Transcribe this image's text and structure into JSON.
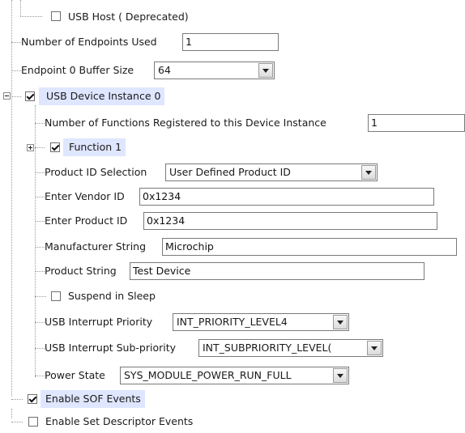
{
  "tree": {
    "usb_host": {
      "label": "USB Host ( Deprecated)",
      "checked": false
    },
    "num_endpoints": {
      "label": "Number of Endpoints Used",
      "value": "1"
    },
    "ep0_buffer": {
      "label": "Endpoint 0 Buffer Size",
      "value": "64"
    },
    "device_instance": {
      "label": "USB Device Instance 0",
      "checked": true
    },
    "num_functions": {
      "label": "Number of Functions Registered to this Device Instance",
      "value": "1"
    },
    "function1": {
      "label": "Function 1",
      "checked": true
    },
    "product_id_selection": {
      "label": "Product ID Selection",
      "value": "User Defined Product ID"
    },
    "vendor_id": {
      "label": "Enter Vendor ID",
      "value": "0x1234"
    },
    "product_id": {
      "label": "Enter Product ID",
      "value": "0x1234"
    },
    "manufacturer": {
      "label": "Manufacturer String",
      "value": "Microchip"
    },
    "product_string": {
      "label": "Product String",
      "value": "Test Device"
    },
    "suspend_sleep": {
      "label": "Suspend in Sleep",
      "checked": false
    },
    "int_priority": {
      "label": "USB Interrupt Priority",
      "value": "INT_PRIORITY_LEVEL4"
    },
    "int_subpriority": {
      "label": "USB Interrupt Sub-priority",
      "value": "INT_SUBPRIORITY_LEVEL("
    },
    "power_state": {
      "label": "Power State",
      "value": "SYS_MODULE_POWER_RUN_FULL"
    },
    "sof_events": {
      "label": "Enable SOF Events",
      "checked": true
    },
    "set_descriptor": {
      "label": "Enable Set Descriptor Events",
      "checked": false
    }
  }
}
